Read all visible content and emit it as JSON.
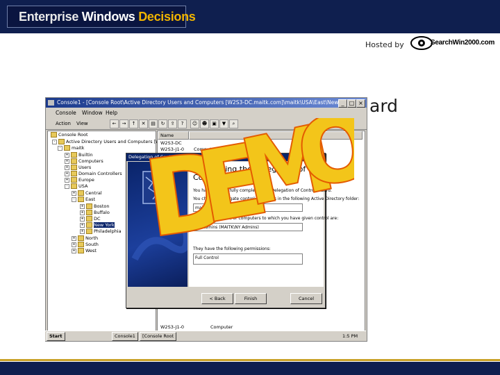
{
  "header": {
    "brand_word1": "Enterprise",
    "brand_word2": "Windows",
    "brand_word3": "Decisions",
    "hosted_by": "Hosted by",
    "logo_text": "SearchWin2000.com"
  },
  "slide": {
    "title_visible_end": "ard"
  },
  "window": {
    "title": "Console1 - [Console Root\\Active Directory Users and Computers [W2S3-DC.maitk.com]\\maitk\\USA\\East\\New York]",
    "menu": [
      "Console",
      "Window",
      "Help"
    ],
    "menu_action": "Action",
    "menu_view": "View",
    "tree_header": "Console Root",
    "tree": [
      "Active Directory Users and Computers [W2S3",
      "maitk",
      "Builtin",
      "Computers",
      "Users",
      "Domain Controllers",
      "Europe",
      "USA",
      "Central",
      "East",
      "Boston",
      "Buffalo",
      "DC",
      "New York",
      "Philadelphia",
      "North",
      "South",
      "West"
    ],
    "list_col_name": "Name",
    "list_rows": [
      "W2S3-DC",
      "W2S3-J1-0"
    ],
    "list_row_type": "Computer",
    "list_bottom_row": "W2S3-J1-0",
    "list_bottom_type": "Computer"
  },
  "wizard": {
    "title": "Delegation of Control Wizard",
    "heading_line1": "Completing the Delegation of",
    "heading_line2": "Control Wizard",
    "text1": "You have successfully completed the Delegation of Control wizard.",
    "text2": "You chose to delegate control of objects in the following Active Directory folder:",
    "box1": "maitk.com/USA/East/New York",
    "text3": "The groups, users, or computers to which you have given control are:",
    "box2": "NY Admins (MAITK\\NY Admins)",
    "text4": "They have the following permissions:",
    "box3": "Full Control",
    "btn_back": "< Back",
    "btn_finish": "Finish",
    "btn_cancel": "Cancel"
  },
  "taskbar": {
    "start": "Start",
    "task1": "Console1",
    "task2": "[Console Root",
    "clock": "1:5 PM"
  },
  "overlay": {
    "letters": [
      "D",
      "E",
      "M",
      "O"
    ]
  }
}
